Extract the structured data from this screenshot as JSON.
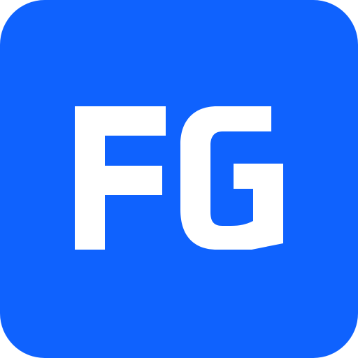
{
  "icon": {
    "monogram": "FG",
    "background_color": "#0F62FE",
    "foreground_color": "#FFFFFF"
  }
}
